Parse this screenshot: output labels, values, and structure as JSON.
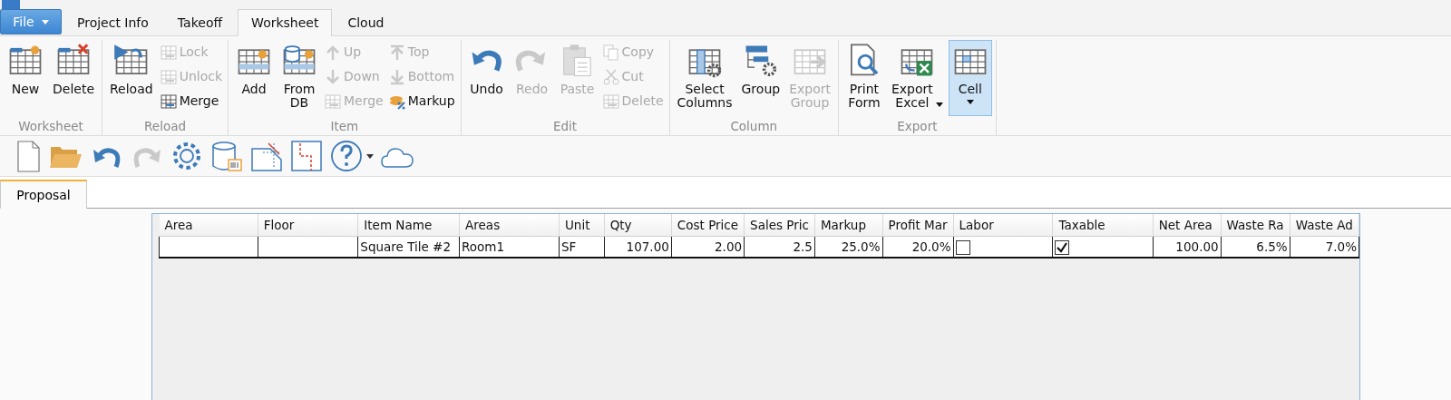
{
  "menu_button": {
    "label": "File"
  },
  "tabs": [
    {
      "label": "Project Info",
      "selected": false
    },
    {
      "label": "Takeoff",
      "selected": false
    },
    {
      "label": "Worksheet",
      "selected": true
    },
    {
      "label": "Cloud",
      "selected": false
    }
  ],
  "ribbon": [
    {
      "label": "Worksheet",
      "items": [
        {
          "kind": "large",
          "label": "New",
          "disabled": false
        },
        {
          "kind": "large",
          "label": "Delete",
          "disabled": false
        }
      ]
    },
    {
      "label": "Reload",
      "items": [
        {
          "kind": "large",
          "label": "Reload",
          "disabled": false
        },
        {
          "kind": "stack",
          "items": [
            {
              "label": "Lock",
              "disabled": true
            },
            {
              "label": "Unlock",
              "disabled": true
            },
            {
              "label": "Merge",
              "disabled": false
            }
          ]
        }
      ]
    },
    {
      "label": "Item",
      "items": [
        {
          "kind": "large",
          "label": "Add",
          "disabled": false
        },
        {
          "kind": "large",
          "label": "From DB",
          "disabled": false
        },
        {
          "kind": "stack",
          "items": [
            {
              "label": "Up",
              "disabled": true
            },
            {
              "label": "Down",
              "disabled": true
            },
            {
              "label": "Merge",
              "disabled": true
            }
          ]
        },
        {
          "kind": "stack",
          "items": [
            {
              "label": "Top",
              "disabled": true
            },
            {
              "label": "Bottom",
              "disabled": true
            },
            {
              "label": "Markup",
              "disabled": false
            }
          ]
        }
      ]
    },
    {
      "label": "Edit",
      "items": [
        {
          "kind": "large",
          "label": "Undo",
          "disabled": false
        },
        {
          "kind": "large",
          "label": "Redo",
          "disabled": true
        },
        {
          "kind": "large",
          "label": "Paste",
          "disabled": true
        },
        {
          "kind": "stack",
          "items": [
            {
              "label": "Copy",
              "disabled": true
            },
            {
              "label": "Cut",
              "disabled": true
            },
            {
              "label": "Delete",
              "disabled": true
            }
          ]
        }
      ]
    },
    {
      "label": "Column",
      "items": [
        {
          "kind": "large",
          "label": "Select Columns",
          "disabled": false
        },
        {
          "kind": "large",
          "label": "Group",
          "disabled": false
        },
        {
          "kind": "large",
          "label": "Export Group",
          "disabled": true
        }
      ]
    },
    {
      "label": "Export",
      "items": [
        {
          "kind": "large",
          "label": "Print Form",
          "disabled": false
        },
        {
          "kind": "large",
          "label": "Export Excel",
          "disabled": false,
          "dropdown": true
        },
        {
          "kind": "split",
          "label": "Cell",
          "disabled": false,
          "dropdown": true,
          "selected": true
        }
      ]
    }
  ],
  "doc_tabs": [
    {
      "label": "Proposal",
      "selected": true
    }
  ],
  "table": {
    "columns": [
      {
        "label": "Area",
        "kind": "text"
      },
      {
        "label": "Floor",
        "kind": "text"
      },
      {
        "label": "Item Name",
        "kind": "text"
      },
      {
        "label": "Areas",
        "kind": "text"
      },
      {
        "label": "Unit",
        "kind": "text"
      },
      {
        "label": "Qty",
        "kind": "number"
      },
      {
        "label": "Cost Price",
        "kind": "number"
      },
      {
        "label": "Sales Pric",
        "kind": "number"
      },
      {
        "label": "Markup",
        "kind": "number"
      },
      {
        "label": "Profit Mar",
        "kind": "number"
      },
      {
        "label": "Labor",
        "kind": "checkbox"
      },
      {
        "label": "Taxable",
        "kind": "checkbox"
      },
      {
        "label": "Net Area",
        "kind": "number"
      },
      {
        "label": "Waste Ra",
        "kind": "number"
      },
      {
        "label": "Waste Ad",
        "kind": "number"
      }
    ],
    "rows": [
      {
        "cells": [
          {},
          {},
          {
            "text": "Square Tile #2"
          },
          {
            "text": "Room1"
          },
          {
            "text": "SF"
          },
          {
            "text": "107.00"
          },
          {
            "text": "2.00"
          },
          {
            "text": "2.5"
          },
          {
            "text": "25.0%"
          },
          {
            "text": "20.0%"
          },
          {
            "checked": false
          },
          {
            "checked": true
          },
          {
            "text": "100.00"
          },
          {
            "text": "6.5%"
          },
          {
            "text": "7.0%"
          }
        ]
      }
    ]
  }
}
